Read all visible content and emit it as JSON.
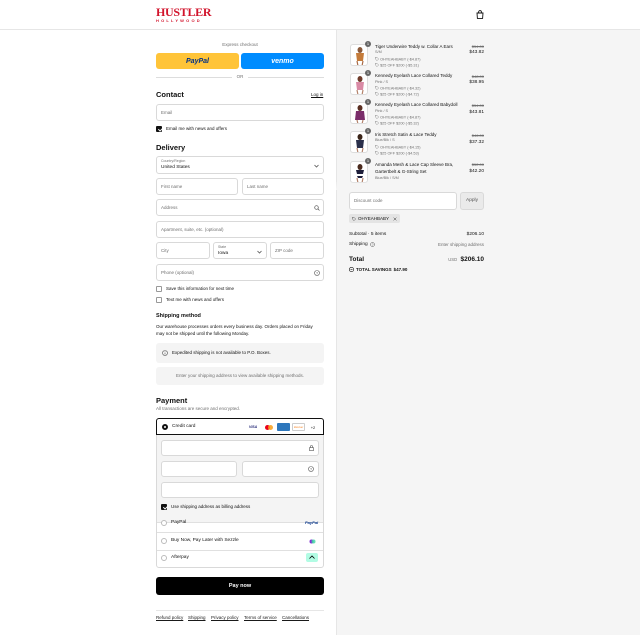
{
  "header": {
    "logo_main": "HUSTLER",
    "logo_sub": "HOLLYWOOD"
  },
  "express": {
    "label": "Express checkout",
    "paypal_label": "PayPal",
    "venmo_label": "venmo",
    "or_label": "OR"
  },
  "contact": {
    "heading": "Contact",
    "login_link": "Log in",
    "email_placeholder": "Email",
    "news_label": "Email me with news and offers"
  },
  "delivery": {
    "heading": "Delivery",
    "country_label": "Country/Region",
    "country_value": "United States",
    "first_name": "First name",
    "last_name": "Last name",
    "address": "Address",
    "apartment": "Apartment, suite, etc. (optional)",
    "city": "City",
    "state_label": "State",
    "state_value": "Iowa",
    "zip": "ZIP code",
    "phone": "Phone (optional)",
    "save_info": "Save this information for next time",
    "text_me": "Text me with news and offers"
  },
  "shipping": {
    "heading": "Shipping method",
    "note_line1": "Our warehouse processes orders every business day. Orders placed on Friday",
    "note_line2": "may not be shipped until the following Monday.",
    "po_notice": "Expedited shipping is not available to P.O. Boxes.",
    "enter_address": "Enter your shipping address to view available shipping methods."
  },
  "payment": {
    "heading": "Payment",
    "subtitle": "All transactions are secure and encrypted.",
    "credit_card": "Credit card",
    "card_more": "+2",
    "billing_same": "Use shipping address as billing address",
    "paypal": "PayPal",
    "paypal_logo": "PayPal",
    "sezzle": "Buy Now, Pay Later with Sezzle",
    "afterpay": "Afterpay",
    "pay_now": "Pay now"
  },
  "footer": {
    "links": [
      "Refund policy",
      "Shipping",
      "Privacy policy",
      "Terms of service",
      "Cancellations"
    ]
  },
  "cart": {
    "items": [
      {
        "qty": "1",
        "name": "Tiger Underwire Teddy w. Collar A Ears",
        "variant": "S/M",
        "discount1": "OHYEAHBABY (-$4.87)",
        "discount2": "$25 OFF $200 (-$5.31)",
        "orig": "$54.00",
        "price": "$43.82"
      },
      {
        "qty": "1",
        "name": "Kennedy Eyelash Lace Collared Teddy",
        "variant": "Pink / S",
        "discount1": "OHYEAHBABY (-$4.32)",
        "discount2": "$25 OFF $200 (-$4.72)",
        "orig": "$48.00",
        "price": "$38.95"
      },
      {
        "qty": "1",
        "name": "Kennedy Eyelash Lace Collared Babydoll",
        "variant": "Pink / S",
        "discount1": "OHYEAHBABY (-$4.87)",
        "discount2": "$25 OFF $200 (-$5.32)",
        "orig": "$54.00",
        "price": "$43.81"
      },
      {
        "qty": "1",
        "name": "Iris Stretch Satin & Lace Teddy",
        "variant": "Blue/Blk / S",
        "discount1": "OHYEAHBABY (-$4.15)",
        "discount2": "$25 OFF $200 (-$4.53)",
        "orig": "$46.00",
        "price": "$37.32"
      },
      {
        "qty": "1",
        "name": "Amanda Mesh & Lace Cap Sleeve Bra,",
        "name2": "Gartertbelt & G-String Set",
        "variant": "Blue/Blk / S/M",
        "orig": "$52.00",
        "price": "$42.20"
      }
    ],
    "discount_placeholder": "Discount code",
    "apply": "Apply",
    "applied_code": "OHYEAHBABY",
    "subtotal_label": "Subtotal · 5 items",
    "subtotal_value": "$206.10",
    "shipping_label": "Shipping",
    "shipping_value": "Enter shipping address",
    "total_label": "Total",
    "currency": "USD",
    "total_value": "$206.10",
    "savings_label": "TOTAL SAVINGS",
    "savings_value": "$47.90"
  },
  "colors": {
    "paypal": "#ffc439",
    "venmo": "#008cff",
    "brand": "#d2142c",
    "pay_button": "#000000"
  }
}
